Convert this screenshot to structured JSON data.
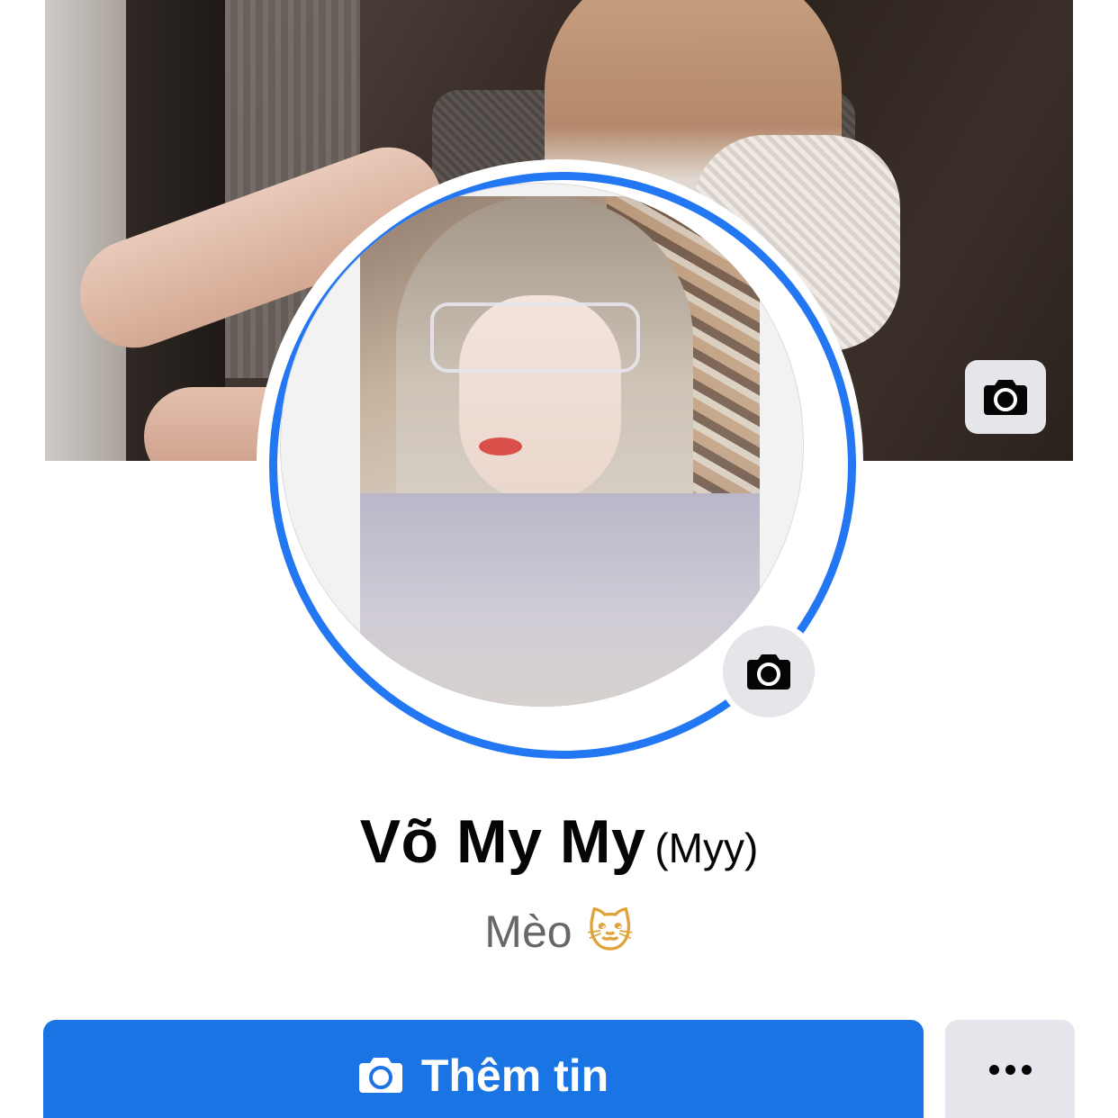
{
  "profile": {
    "name": "Võ My My",
    "alternate_name": "(Myy)",
    "bio_text": "Mèo",
    "bio_emoji": "🐱"
  },
  "cover": {
    "camera_icon": "camera-icon"
  },
  "avatar": {
    "camera_icon": "camera-icon",
    "ring_color": "#2477f2"
  },
  "actions": {
    "add_story_label": "Thêm tin",
    "add_story_icon": "camera-icon",
    "more_icon": "more-horizontal-icon"
  },
  "colors": {
    "primary": "#1b74e4",
    "secondary_button": "#e4e6eb",
    "text_primary": "#050505",
    "text_secondary": "#65676b"
  }
}
